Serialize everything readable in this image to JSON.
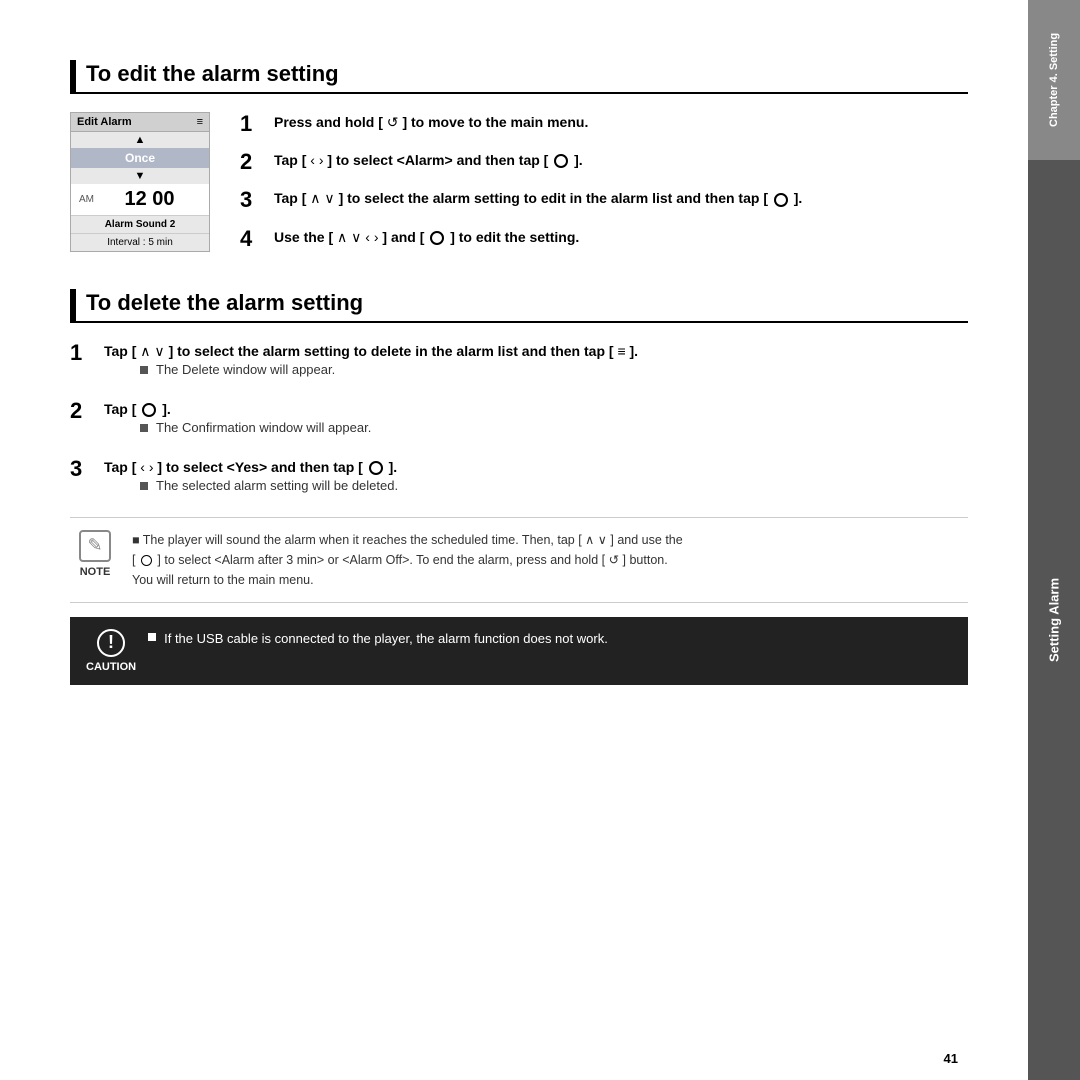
{
  "page": {
    "number": "41"
  },
  "sidebar": {
    "chapter_label": "Chapter 4. Setting",
    "setting_alarm_label": "Setting Alarm"
  },
  "edit_alarm": {
    "section_title": "To edit the alarm setting",
    "device": {
      "header_title": "Edit Alarm",
      "header_icon": "≡",
      "arrow_up": "▲",
      "once_label": "Once",
      "arrow_down": "▼",
      "am_label": "AM",
      "time_hours": "12",
      "time_colon": "",
      "time_minutes": "00",
      "alarm_sound_label": "Alarm Sound 2",
      "interval_label": "Interval : 5 min"
    },
    "steps": [
      {
        "number": "1",
        "text": "Press and hold [ ↺ ] to move to the main menu."
      },
      {
        "number": "2",
        "text": "Tap [ ‹ › ] to select <Alarm> and then tap [ ⊙ ]."
      },
      {
        "number": "3",
        "text": "Tap [ ∧ ∨ ] to select the alarm setting to edit in the alarm list and then tap [ ⊙ ]."
      },
      {
        "number": "4",
        "text": "Use the [ ∧ ∨ ‹ › ] and [ ⊙ ] to edit the setting."
      }
    ]
  },
  "delete_alarm": {
    "section_title": "To delete the alarm setting",
    "steps": [
      {
        "number": "1",
        "text": "Tap [ ∧ ∨ ] to select the alarm setting to delete in the alarm list and then tap [ ≡ ].",
        "bullet": "The Delete window will appear."
      },
      {
        "number": "2",
        "text": "Tap [ ⊙ ].",
        "bullet": "The Confirmation window will appear."
      },
      {
        "number": "3",
        "text": "Tap [ ‹ › ] to select <Yes> and then tap [ ⊙ ].",
        "bullet": "The selected alarm setting will be deleted."
      }
    ]
  },
  "note": {
    "icon_label": "NOTE",
    "pencil_symbol": "✎",
    "lines": [
      "The player will sound the alarm when it reaches the scheduled time. Then, tap [ ∧ ∨ ] and use the",
      "[ ⊙ ] to select <Alarm after 3 min> or <Alarm Off>. To end the alarm, press and hold [ ↺ ] button.",
      "You will return to the main menu."
    ]
  },
  "caution": {
    "icon_label": "CAUTION",
    "exclaim": "!",
    "text": "If the USB cable is connected to  the player, the alarm function does not work."
  }
}
